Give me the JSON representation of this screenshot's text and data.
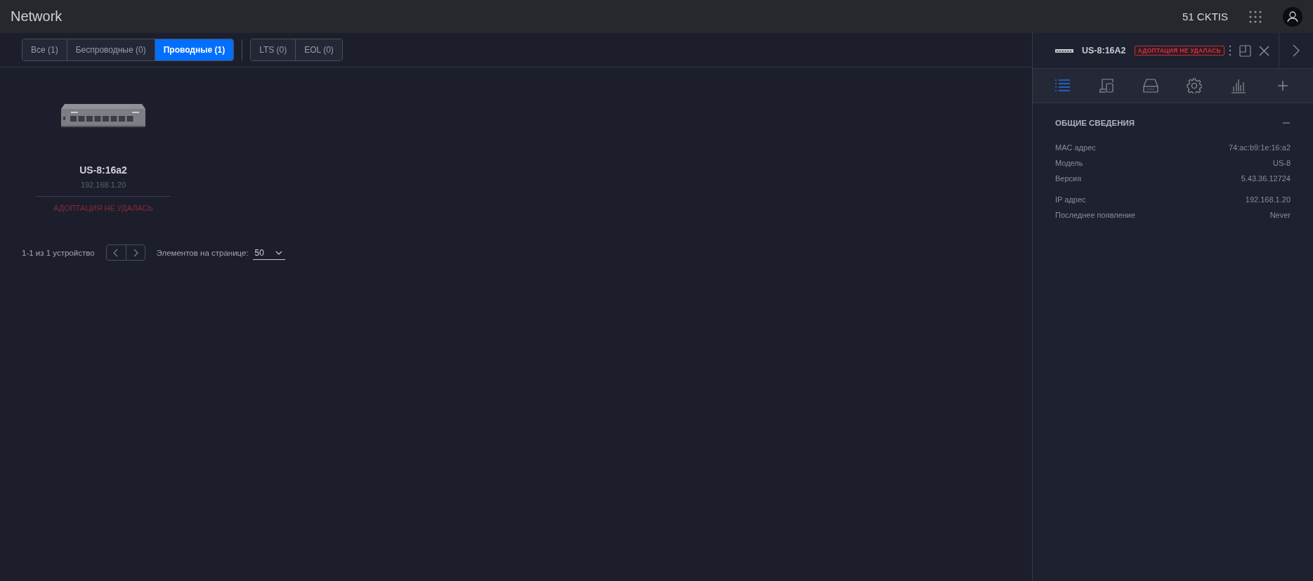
{
  "header": {
    "title": "Network",
    "site": "51 CKTIS"
  },
  "filters": [
    {
      "label": "Все (1)",
      "selected": false
    },
    {
      "label": "Беспроводные (0)",
      "selected": false
    },
    {
      "label": "Проводные (1)",
      "selected": true
    }
  ],
  "support_filters": [
    {
      "label": "LTS (0)",
      "selected": false
    },
    {
      "label": "EOL (0)",
      "selected": false
    }
  ],
  "devices": [
    {
      "name": "US-8:16a2",
      "ip": "192.168.1.20",
      "status": "АДОПТАЦИЯ НЕ УДАЛАСЬ"
    }
  ],
  "pagination": {
    "summary": "1-1 из 1 устройство",
    "per_page_label": "Элементов на странице:",
    "per_page": "50"
  },
  "panel": {
    "device_name": "US-8:16A2",
    "status_badge": "АДОПТАЦИЯ НЕ УДАЛАСЬ",
    "tabs": [
      {
        "kind": "list",
        "selected": true
      },
      {
        "kind": "devices",
        "selected": false
      },
      {
        "kind": "drive",
        "selected": false
      },
      {
        "kind": "gear",
        "selected": false
      },
      {
        "kind": "bars",
        "selected": false
      },
      {
        "kind": "plus",
        "selected": false
      }
    ],
    "section": {
      "title": "ОБЩИЕ СВЕДЕНИЯ",
      "expanded": true,
      "groups": [
        [
          {
            "label": "MAC адрес",
            "value": "74:ac:b9:1e:16:a2"
          },
          {
            "label": "Модель",
            "value": "US-8"
          },
          {
            "label": "Версия",
            "value": "5.43.36.12724"
          }
        ],
        [
          {
            "label": "IP адрес",
            "value": "192.168.1.20"
          },
          {
            "label": "Последнее появление",
            "value": "Never"
          }
        ]
      ]
    }
  }
}
